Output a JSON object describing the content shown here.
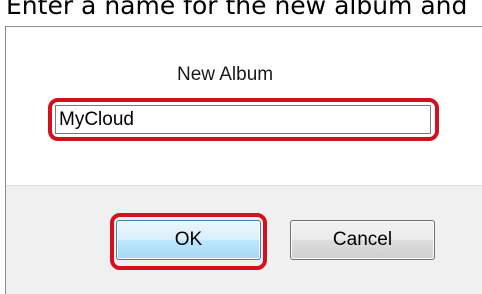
{
  "instruction_text": "Enter a name for the new album and",
  "dialog": {
    "prompt": "New Album",
    "name_value": "MyCloud",
    "ok_label": "OK",
    "cancel_label": "Cancel"
  },
  "colors": {
    "highlight": "#d4101c",
    "footer_background": "#f0f0f0"
  }
}
